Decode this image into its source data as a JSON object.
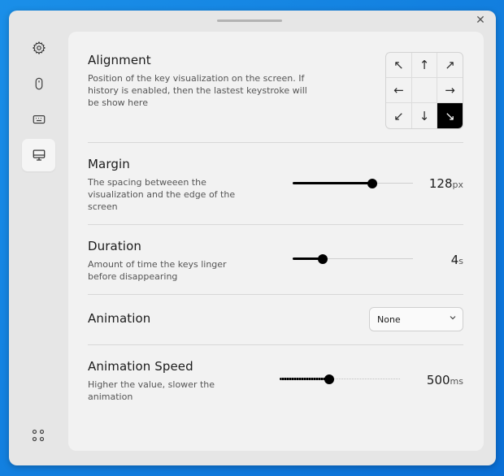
{
  "window": {
    "close_glyph": "✕"
  },
  "sidebar": {
    "items": [
      {
        "name": "settings",
        "icon": "gear-icon",
        "active": false
      },
      {
        "name": "mouse",
        "icon": "mouse-icon",
        "active": false
      },
      {
        "name": "keyboard",
        "icon": "keyboard-icon",
        "active": false
      },
      {
        "name": "display",
        "icon": "monitor-icon",
        "active": true
      }
    ],
    "bottom_icon": "apps-grid-icon"
  },
  "alignment": {
    "title": "Alignment",
    "description": "Position of the key visualization on the screen. If history is enabled, then the lastest keystroke will be show here",
    "grid": [
      "↖",
      "↑",
      "↗",
      "←",
      "",
      "→",
      "↙",
      "↓",
      "↘"
    ],
    "selected": "bottom-right"
  },
  "margin": {
    "title": "Margin",
    "description": "The spacing betweeen the visualization and the edge of the screen",
    "value": "128",
    "unit": "px",
    "fraction": 0.66
  },
  "duration": {
    "title": "Duration",
    "description": "Amount of time the keys linger before disappearing",
    "value": "4",
    "unit": "s",
    "fraction": 0.25
  },
  "animation": {
    "title": "Animation",
    "selected": "None"
  },
  "animation_speed": {
    "title": "Animation Speed",
    "description": "Higher the value, slower the animation",
    "value": "500",
    "unit": "ms",
    "fraction": 0.41
  },
  "colors": {
    "background": "#0a6fd6",
    "window": "#e6e6e6",
    "panel": "#f2f2f2",
    "accent": "#000000"
  }
}
